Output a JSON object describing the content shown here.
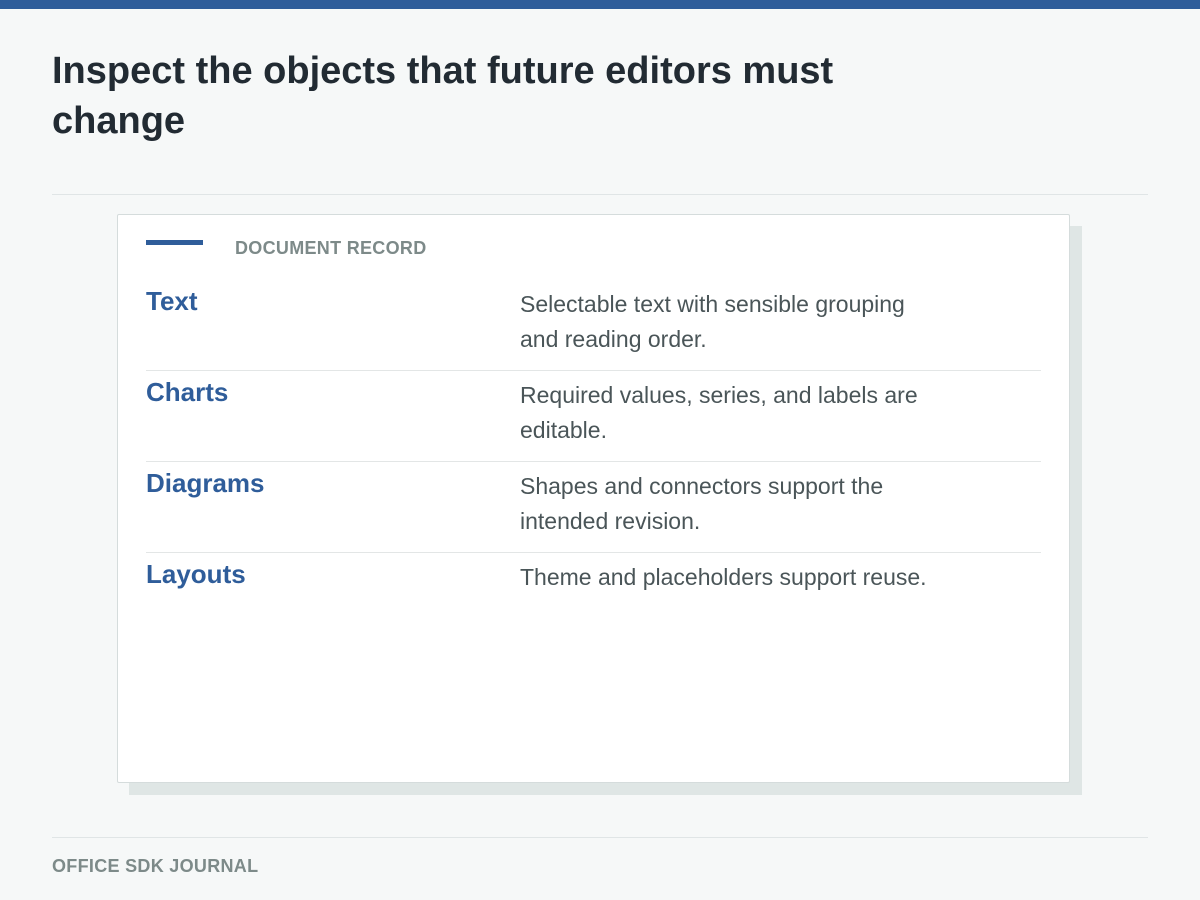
{
  "header": {
    "title": "Inspect the objects that future editors must change"
  },
  "card": {
    "kicker": "DOCUMENT RECORD",
    "rows": [
      {
        "term": "Text",
        "description": "Selectable text with sensible grouping and reading order."
      },
      {
        "term": "Charts",
        "description": "Required values, series, and labels are editable."
      },
      {
        "term": "Diagrams",
        "description": "Shapes and connectors support the intended revision."
      },
      {
        "term": "Layouts",
        "description": "Theme and placeholders support reuse."
      }
    ]
  },
  "footer": {
    "label": "OFFICE SDK JOURNAL"
  },
  "colors": {
    "accent": "#2f5d9a",
    "title": "#222b33",
    "muted": "#7d8a89",
    "background": "#f6f8f8"
  }
}
